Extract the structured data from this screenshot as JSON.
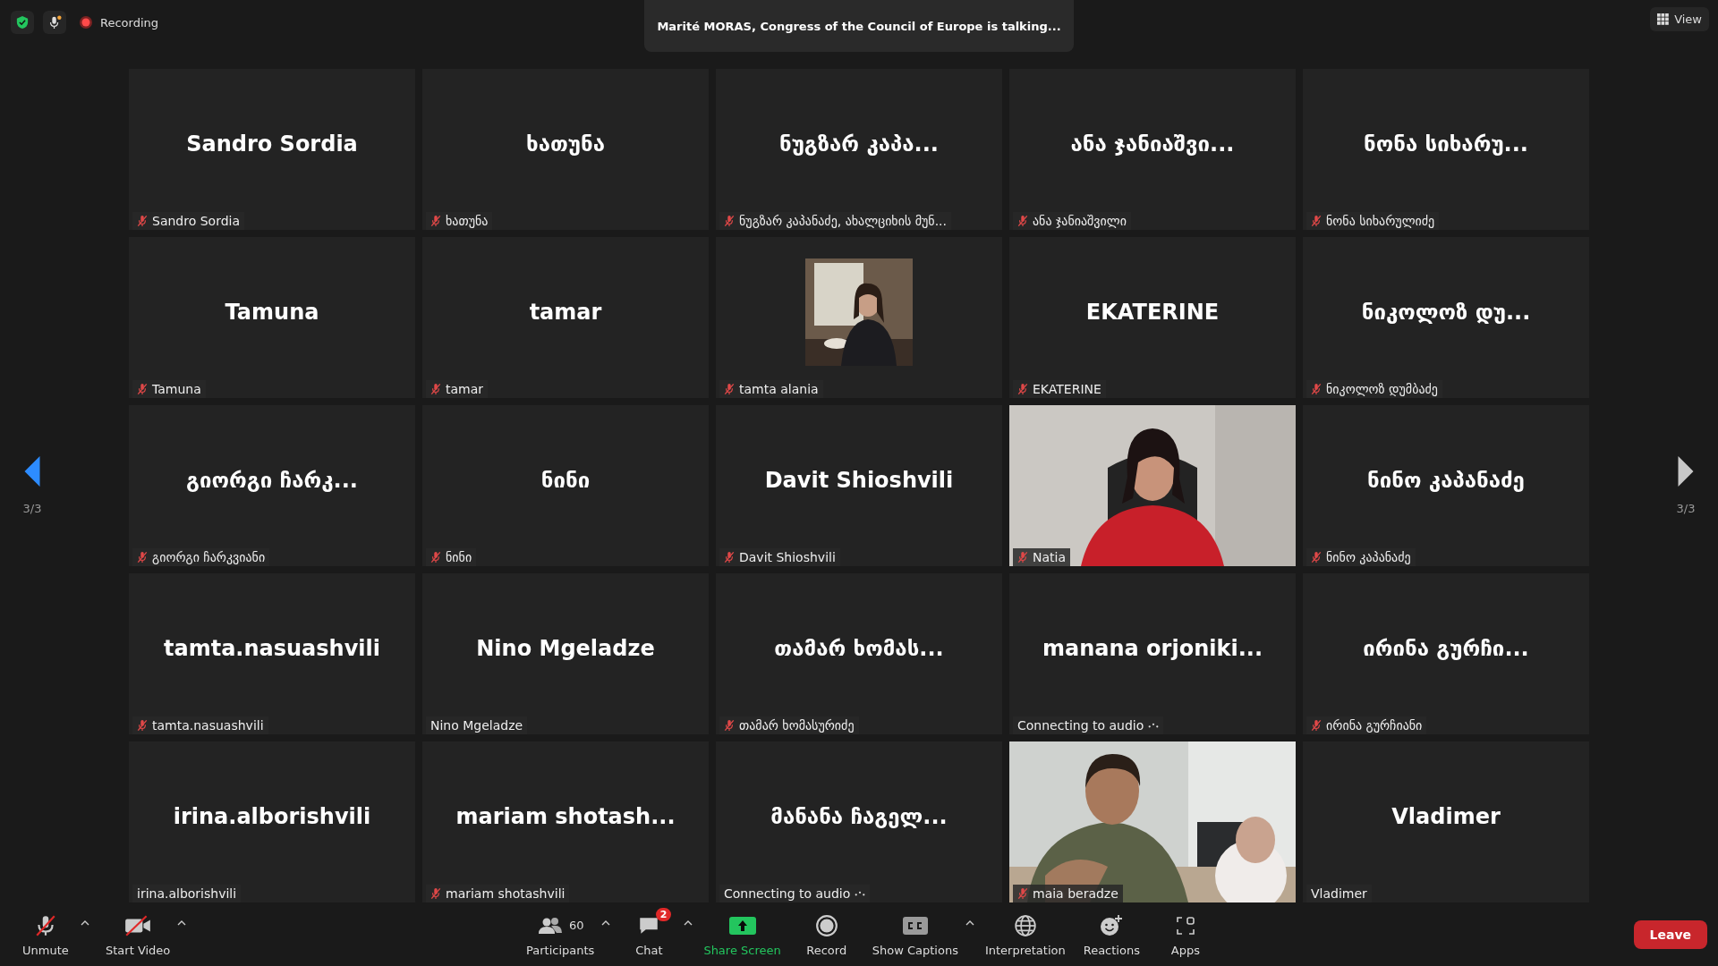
{
  "top_bar": {
    "recording_label": "Recording",
    "speaker_banner": "Marité MORAS, Congress of the Council of Europe is talking...",
    "view_button": "View"
  },
  "pager": {
    "left": "3/3",
    "right": "3/3"
  },
  "tiles": [
    {
      "kind": "name",
      "title": "Sandro Sordia",
      "label": "Sandro Sordia",
      "muted": true
    },
    {
      "kind": "name",
      "title": "ხათუნა",
      "label": "ხათუნა",
      "muted": true
    },
    {
      "kind": "name",
      "title": "ნუგზარ კაპა...",
      "label": "ნუგზარ კაპანაძე, ახალციხის მუნ...",
      "muted": true
    },
    {
      "kind": "name",
      "title": "ანა ჯანიაშვი...",
      "label": "ანა ჯანიაშვილი",
      "muted": true
    },
    {
      "kind": "name",
      "title": "ნონა სიხარუ...",
      "label": "ნონა სიხარულიძე",
      "muted": true
    },
    {
      "kind": "name",
      "title": "Tamuna",
      "label": "Tamuna",
      "muted": true
    },
    {
      "kind": "name",
      "title": "tamar",
      "label": "tamar",
      "muted": true
    },
    {
      "kind": "small_video",
      "label": "tamta alania",
      "muted": true
    },
    {
      "kind": "name",
      "title": "EKATERINE",
      "label": "EKATERINE",
      "muted": true
    },
    {
      "kind": "name",
      "title": "ნიკოლოზ დუ...",
      "label": "ნიკოლოზ დუმბაძე",
      "muted": true
    },
    {
      "kind": "name",
      "title": "გიორგი ჩარკ...",
      "label": "გიორგი ჩარკვიანი",
      "muted": true
    },
    {
      "kind": "name",
      "title": "ნინი",
      "label": "ნინი",
      "muted": true
    },
    {
      "kind": "name",
      "title": "Davit Shioshvili",
      "label": "Davit Shioshvili",
      "muted": true
    },
    {
      "kind": "video",
      "label": "Natia",
      "muted": true
    },
    {
      "kind": "name",
      "title": "ნინო კაპანაძე",
      "label": "ნინო კაპანაძე",
      "muted": true
    },
    {
      "kind": "name",
      "title": "tamta.nasuashvili",
      "label": "tamta.nasuashvili",
      "muted": true
    },
    {
      "kind": "name",
      "title": "Nino Mgeladze",
      "label": "Nino Mgeladze",
      "muted": false
    },
    {
      "kind": "name",
      "title": "თამარ ხომას...",
      "label": "თამარ ხომასურიძე",
      "muted": true
    },
    {
      "kind": "name",
      "title": "manana orjoniki...",
      "label": "Connecting to audio",
      "muted": false,
      "connecting": true
    },
    {
      "kind": "name",
      "title": "ირინა გურჩი...",
      "label": "ირინა გურჩიანი",
      "muted": true
    },
    {
      "kind": "name",
      "title": "irina.alborishvili",
      "label": "irina.alborishvili",
      "muted": false
    },
    {
      "kind": "name",
      "title": "mariam shotash...",
      "label": "mariam shotashvili",
      "muted": true
    },
    {
      "kind": "name",
      "title": "მანანა ჩაგელ...",
      "label": "Connecting to audio",
      "muted": false,
      "connecting": true
    },
    {
      "kind": "video",
      "label": "maia beradze",
      "muted": true
    },
    {
      "kind": "name",
      "title": "Vladimer",
      "label": "Vladimer",
      "muted": false
    }
  ],
  "toolbar": {
    "left": [
      {
        "kind": "unmute",
        "label": "Unmute",
        "menu": true
      },
      {
        "kind": "start_video",
        "label": "Start Video",
        "menu": true
      }
    ],
    "center": [
      {
        "kind": "participants",
        "label": "Participants",
        "count": "60",
        "menu": true
      },
      {
        "kind": "chat",
        "label": "Chat",
        "badge": "2",
        "menu": true
      },
      {
        "kind": "share",
        "label": "Share Screen",
        "menu": false
      },
      {
        "kind": "record",
        "label": "Record",
        "menu": false
      },
      {
        "kind": "captions",
        "label": "Show Captions",
        "menu": true
      },
      {
        "kind": "interpretation",
        "label": "Interpretation",
        "menu": false
      },
      {
        "kind": "reactions",
        "label": "Reactions",
        "menu": false
      },
      {
        "kind": "apps",
        "label": "Apps",
        "menu": false
      }
    ],
    "leave": "Leave"
  }
}
